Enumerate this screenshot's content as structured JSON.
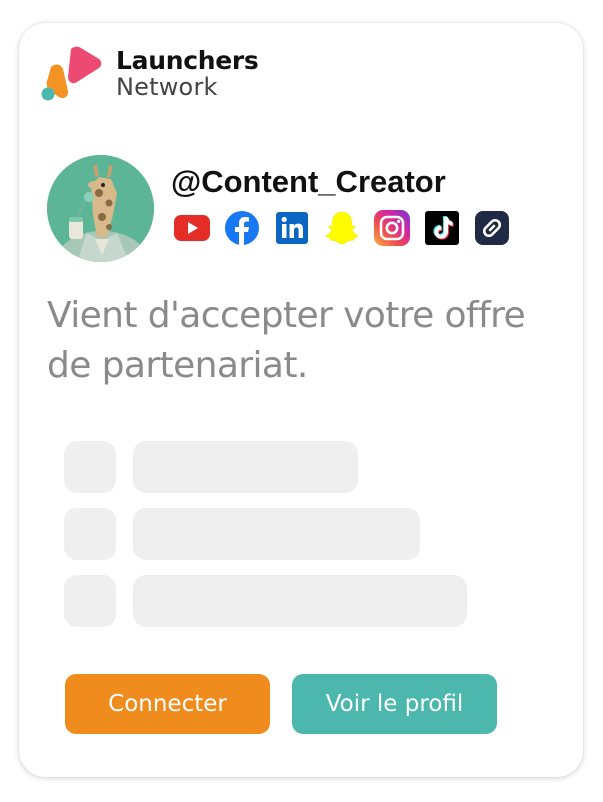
{
  "brand": {
    "name": "Launchers",
    "subtitle": "Network",
    "logo_icon": "launchers-logo-icon",
    "colors": {
      "pink": "#ec4a72",
      "orange": "#f39323",
      "teal": "#4cb8ad"
    }
  },
  "profile": {
    "avatar_icon": "giraffe-avatar",
    "username": "@Content_Creator",
    "socials": [
      {
        "name": "youtube-icon",
        "color": "#e52d27"
      },
      {
        "name": "facebook-icon",
        "color": "#1877f2"
      },
      {
        "name": "linkedin-icon",
        "color": "#0a66c2"
      },
      {
        "name": "snapchat-icon",
        "color": "#fffc00"
      },
      {
        "name": "instagram-icon",
        "color": "#d6249f"
      },
      {
        "name": "tiktok-icon",
        "color": "#000000"
      },
      {
        "name": "link-icon",
        "color": "#1f2a44"
      }
    ]
  },
  "message": "Vient d'accepter votre offre de partenariat.",
  "placeholder_rows": 3,
  "actions": {
    "connect_label": "Connecter",
    "profile_label": "Voir le profil",
    "connect_color": "#f08c1e",
    "profile_color": "#4cb8ad"
  }
}
